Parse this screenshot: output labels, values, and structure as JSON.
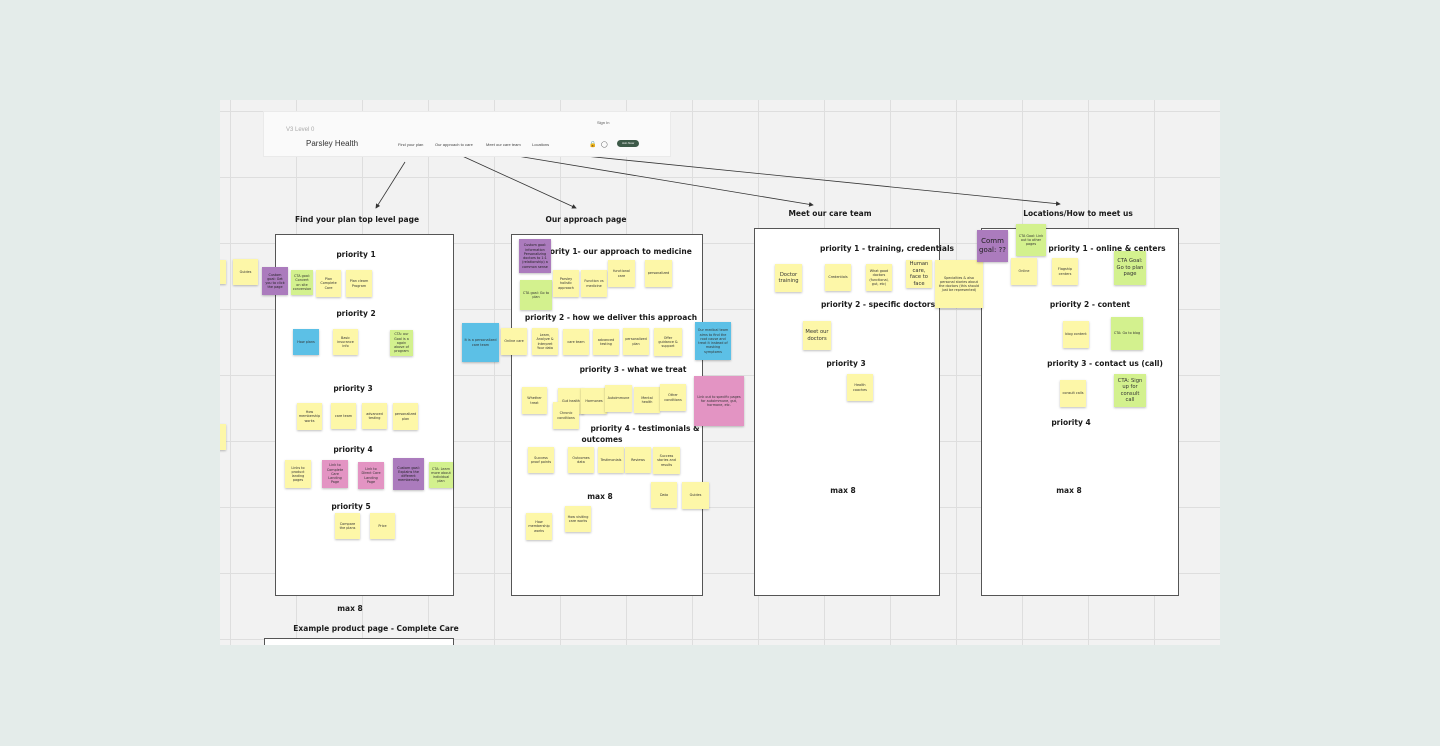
{
  "navbar": {
    "level": "V3 Level 0",
    "signin": "Sign In",
    "logo": "Parsley Health",
    "links": [
      "Find your plan",
      "Our approach to care",
      "Meet our care team",
      "Locations"
    ],
    "cta": "Join Now"
  },
  "sections": {
    "find_plan": {
      "title": "Find your plan top level page",
      "p1": "priority 1",
      "p2": "priority 2",
      "p3": "priority 3",
      "p4": "priority 4",
      "p5": "priority 5",
      "max": "max 8",
      "example": "Example product page - Complete Care"
    },
    "approach": {
      "title": "Our approach page",
      "p1": "priority 1- our approach to medicine",
      "p2": "priority 2 - how we deliver this approach",
      "p3": "priority 3 - what we treat",
      "p4a": "priority 4 - testimonials &",
      "p4b": "outcomes",
      "max": "max 8"
    },
    "care_team": {
      "title": "Meet our care team",
      "p1": "priority 1 - training, credentials",
      "p2": "priority 2 - specific doctors",
      "p3": "priority 3",
      "max": "max 8"
    },
    "locations": {
      "title": "Locations/How to meet us",
      "p1": "priority 1 - online & centers",
      "p2": "priority 2 - content",
      "p3": "priority 3 - contact us (call)",
      "p4": "priority 4",
      "max": "max 8"
    }
  },
  "notes": {
    "fp_guides": "Guides",
    "fp_custom_goal": "Custom goal: Get you to click the page",
    "fp_cta_goal": "CTA goal: Convert on site conversion",
    "fp_plan_complete": "Plan Complete Care",
    "fp_plan_program": "Plan cleam Program",
    "fp_how_plans": "How plans",
    "fp_basic_insurance": "Basic insurance info",
    "fp_cta_our_goal": "CTA: our Goal is a again above of program",
    "fp_how_membership": "How membership works",
    "fp_care_team": "care team",
    "fp_advanced_testing": "advanced testing",
    "fp_personalized_plan": "personalized plan",
    "fp_links_product": "Links to product landing pages",
    "fp_links_complete": "Link to Complete Care Landing Page",
    "fp_links_direct": "Link to Direct Care Landing Page",
    "fp_custom_explain": "Custom goal: Explains the different membership",
    "fp_cta_learn": "CTA: Learn more about individual plan",
    "fp_compare": "Compare the plans",
    "fp_price": "Price",
    "ap_custom_goal": "Custom goal: information Personalizing doctors to 1:1 (relationship) a common sense",
    "ap_cta_goal": "CTA goal: Go to plan",
    "ap_parsley_holistic": "Parsley holistic approach",
    "ap_function_vs": "Function vs medicine",
    "ap_functional_care": "functional care",
    "ap_personalized": "personalized",
    "ap_blue_left": "It is a personalized care team",
    "ap_online_care": "Online care",
    "ap_learn_analyze": "Learn, Analyze & Interpret Your data",
    "ap_care_team": "care team",
    "ap_advanced_testing": "advanced testing",
    "ap_personalized_plan": "personalized plan",
    "ap_offer_guidance": "Offer guidance & support",
    "ap_blue_right": "Our medical team aims to find the root cause and treat it instead of masking symptoms",
    "ap_whether_treat": "Whether treat",
    "ap_gut_health": "Gut health",
    "ap_hormones": "Hormones",
    "ap_autoimmune": "Autoimmune",
    "ap_mental_health": "Mental health",
    "ap_other_conditions": "Other conditions",
    "ap_chronic_conditions": "Chronic conditions",
    "ap_pink_link": "Link out to specific pages for autoimmune, gut, hormone, etc.",
    "ap_success_proof": "Success proof points",
    "ap_outcomes_data": "Outcomes data",
    "ap_testimonials": "Testimonials",
    "ap_reviews": "Reviews",
    "ap_success_stories": "Success stories and results",
    "ap_data": "Data",
    "ap_guides": "Guides",
    "ap_how_membership": "How membership works",
    "ap_how_visits": "How visiting care works",
    "ct_doctor_training": "Doctor training",
    "ct_credentials": "Credentials",
    "ct_what_good": "What good doctors (functional, gut, etc)",
    "ct_human_care": "Human care, face to face",
    "ct_specialties": "Specialties & also personal stories about the doctors (this should just be represented)",
    "ct_meet_doctors": "Meet our doctors",
    "ct_health_coaches": "Health coaches",
    "lo_comm_goal": "Comm goal: ??",
    "lo_cta_link_out": "CTA Goal: Link out to other pages",
    "lo_online": "Online",
    "lo_flagship": "Flagship centers",
    "lo_cta_plan": "CTA Goal: Go to plan page",
    "lo_blog_content": "blog content",
    "lo_cta_blog": "CTA: Go to blog",
    "lo_consult_calls": "consult calls",
    "lo_cta_signup": "CTA: Sign up for consult call"
  }
}
